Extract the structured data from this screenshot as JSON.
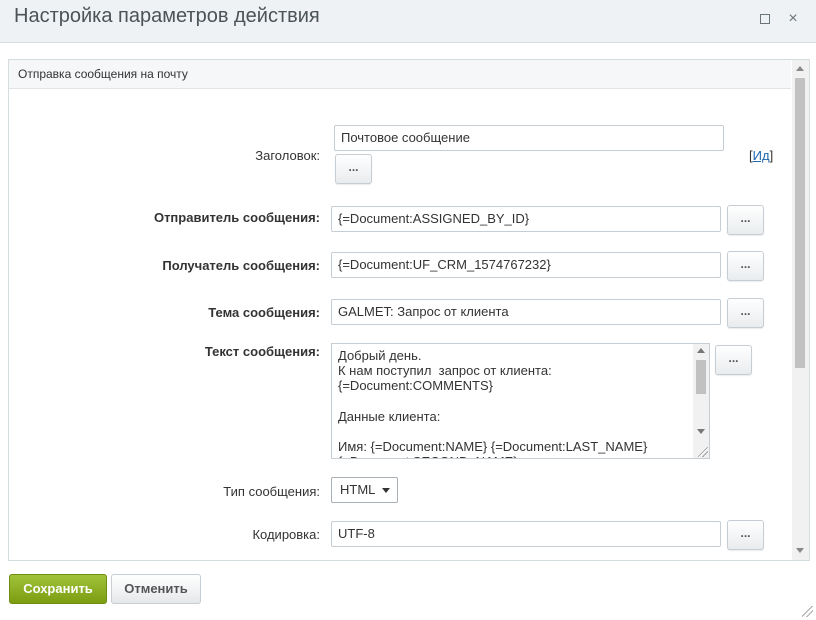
{
  "dialog": {
    "title": "Настройка параметров действия",
    "maximize_icon": "maximize-icon",
    "close_icon": "close-icon",
    "close_glyph": "×"
  },
  "section": {
    "title": "Отправка сообщения на почту"
  },
  "form": {
    "subject_header": {
      "label": "Заголовок:",
      "value": "Почтовое сообщение",
      "ident_prefix": "[",
      "ident_link": "Ид",
      "ident_suffix": "]"
    },
    "sender": {
      "label": "Отправитель сообщения:",
      "value": "{=Document:ASSIGNED_BY_ID}"
    },
    "recipient": {
      "label": "Получатель сообщения:",
      "value": "{=Document:UF_CRM_1574767232}"
    },
    "topic": {
      "label": "Тема сообщения:",
      "value": "GALMET: Запрос от клиента"
    },
    "body": {
      "label": "Текст сообщения:",
      "value": "Добрый день.\nК нам поступил  запрос от клиента:\n{=Document:COMMENTS}\n\nДанные клиента:\n\nИмя: {=Document:NAME} {=Document:LAST_NAME}\n{=Document:SECOND_NAME}"
    },
    "message_type": {
      "label": "Тип сообщения:",
      "value": "HTML"
    },
    "encoding": {
      "label": "Кодировка:",
      "value": "UTF-8"
    },
    "dots_label": "..."
  },
  "buttons": {
    "save": "Сохранить",
    "cancel": "Отменить"
  },
  "colors": {
    "save_bg": "#8cb023",
    "link": "#2067b0",
    "titlebar_bg": "#eef2f4"
  }
}
